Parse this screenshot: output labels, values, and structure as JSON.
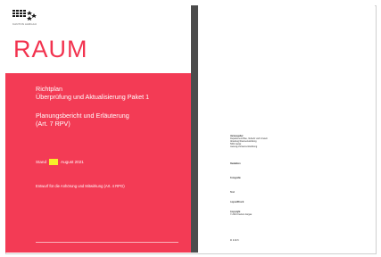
{
  "cover": {
    "logo_caption": "KANTON AARGAU",
    "title": "RAUM",
    "subtitle_lines": [
      "Richtplan",
      "Überprüfung und Aktualisierung Paket 1"
    ],
    "report_lines": [
      "Planungsbericht und Erläuterung",
      "(Art. 7 RPV)"
    ],
    "status_prefix": "Stand",
    "status_date": "August 2021",
    "draft_note": "Entwurf für die Anhörung und Mitwirkung (Art. 4 RPG)"
  },
  "colors": {
    "accent_red": "#f33b55",
    "title_red": "#f2334f",
    "highlight_yellow": "#f7ee2a",
    "spine": "#4c4c4c"
  },
  "imprint": {
    "publisher_heading": "Herausgeber",
    "publisher_lines": [
      "Departement Bau, Verkehr und Umwelt",
      "Abteilung Raumentwicklung",
      "5001 Aarau",
      "www.ag.ch/raumentwicklung"
    ],
    "editor_heading": "Redaktion",
    "photos_heading": "Fotografie",
    "text_heading": "Text",
    "layout_heading": "Layout/Druck",
    "copyright_heading": "Copyright",
    "copyright_line": "© 2021 Kanton Aargau",
    "footer_code": "IK 0.00.5"
  }
}
